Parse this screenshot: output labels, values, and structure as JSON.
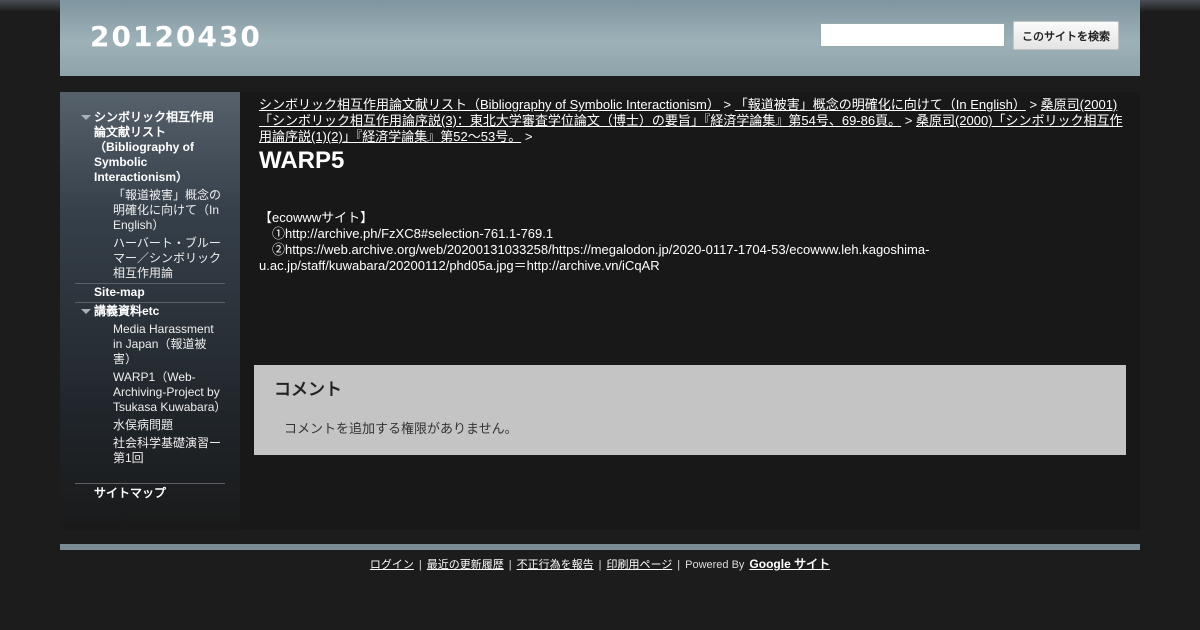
{
  "site": {
    "title": "20120430"
  },
  "search": {
    "placeholder": "",
    "button_label": "このサイトを検索"
  },
  "sidebar": {
    "items": [
      {
        "label": "シンボリック相互作用論文献リスト（Bibliography of Symbolic Interactionism）",
        "children": [
          "「報道被害」概念の明確化に向けて（In English）",
          "ハーバート・ブルーマー／シンボリック相互作用論"
        ]
      },
      {
        "label": "Site-map"
      },
      {
        "label": "講義資料etc",
        "children": [
          "Media Harassment in Japan（報道被害）",
          "WARP1（Web-Archiving-Project by Tsukasa Kuwabara）",
          "水俣病問題",
          "社会科学基礎演習ー第1回"
        ]
      },
      {
        "label": "サイトマップ"
      }
    ]
  },
  "breadcrumb": {
    "items": [
      "シンボリック相互作用論文献リスト（Bibliography of Symbolic Interactionism）",
      "「報道被害」概念の明確化に向けて（In English）",
      "桑原司(2001)「シンボリック相互作用論序説(3)：東北大学審査学位論文（博士）の要旨」『経済学論集』第54号、69-86頁。",
      "桑原司(2000)「シンボリック相互作用論序説(1)(2)」『経済学論集』第52～53号。"
    ],
    "separator": ">"
  },
  "page": {
    "title": "WARP5",
    "lines": [
      "【ecowwwサイト】",
      "　①http://archive.ph/FzXC8#selection-761.1-769.1",
      "　②https://web.archive.org/web/20200131033258/https://megalodon.jp/2020-0117-1704-53/ecowww.leh.kagoshima-u.ac.jp/staff/kuwabara/20200112/phd05a.jpg＝http://archive.vn/iCqAR"
    ]
  },
  "comments": {
    "title": "コメント",
    "note": "コメントを追加する権限がありません。"
  },
  "footer": {
    "links": [
      "ログイン",
      "最近の更新履歴",
      "不正行為を報告",
      "印刷用ページ"
    ],
    "separator": "|",
    "powered_by": "Powered By",
    "google_sites": "Google サイト"
  }
}
